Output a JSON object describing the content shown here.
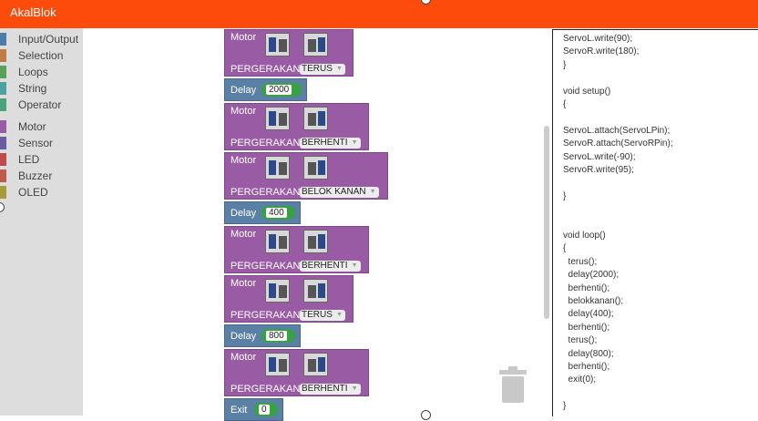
{
  "app": {
    "title": "AkalBlok"
  },
  "toolbox": {
    "items": [
      {
        "label": "Input/Output",
        "color": "#4c7da8"
      },
      {
        "label": "Selection",
        "color": "#c07a46"
      },
      {
        "label": "Loops",
        "color": "#55a35a"
      },
      {
        "label": "String",
        "color": "#4ba39f"
      },
      {
        "label": "Operator",
        "color": "#4aa37a"
      },
      {
        "label": "Motor",
        "color": "#9a5ba5"
      },
      {
        "label": "Sensor",
        "color": "#6a5ba5"
      },
      {
        "label": "LED",
        "color": "#c04a4a"
      },
      {
        "label": "Buzzer",
        "color": "#c05a4a"
      },
      {
        "label": "OLED",
        "color": "#a89b3a"
      }
    ]
  },
  "workspace": {
    "motor_label": "Motor",
    "pergerakan_label": "PERGERAKAN",
    "delay_label": "Delay",
    "exit_label": "Exit",
    "blocks": [
      {
        "type": "motor",
        "value": "TERUS"
      },
      {
        "type": "delay",
        "value": "2000"
      },
      {
        "type": "motor",
        "value": "BERHENTI"
      },
      {
        "type": "motor",
        "value": "BELOK KANAN"
      },
      {
        "type": "delay",
        "value": "400"
      },
      {
        "type": "motor",
        "value": "BERHENTI"
      },
      {
        "type": "motor",
        "value": "TERUS"
      },
      {
        "type": "delay",
        "value": "800"
      },
      {
        "type": "motor",
        "value": "BERHENTI"
      },
      {
        "type": "exit",
        "value": "0"
      }
    ]
  },
  "code": {
    "lines": [
      "ServoL.write(90);",
      "ServoR.write(180);",
      "}",
      "",
      "void setup()",
      "{",
      "",
      "ServoL.attach(ServoLPin);",
      "ServoR.attach(ServoRPin);",
      "ServoL.write(-90);",
      "ServoR.write(95);",
      "",
      "}",
      "",
      "",
      "void loop()",
      "{",
      "  terus();",
      "  delay(2000);",
      "  berhenti();",
      "  belokkanan();",
      "  delay(400);",
      "  berhenti();",
      "  terus();",
      "  delay(800);",
      "  berhenti();",
      "  exit(0);",
      "",
      "}"
    ]
  }
}
